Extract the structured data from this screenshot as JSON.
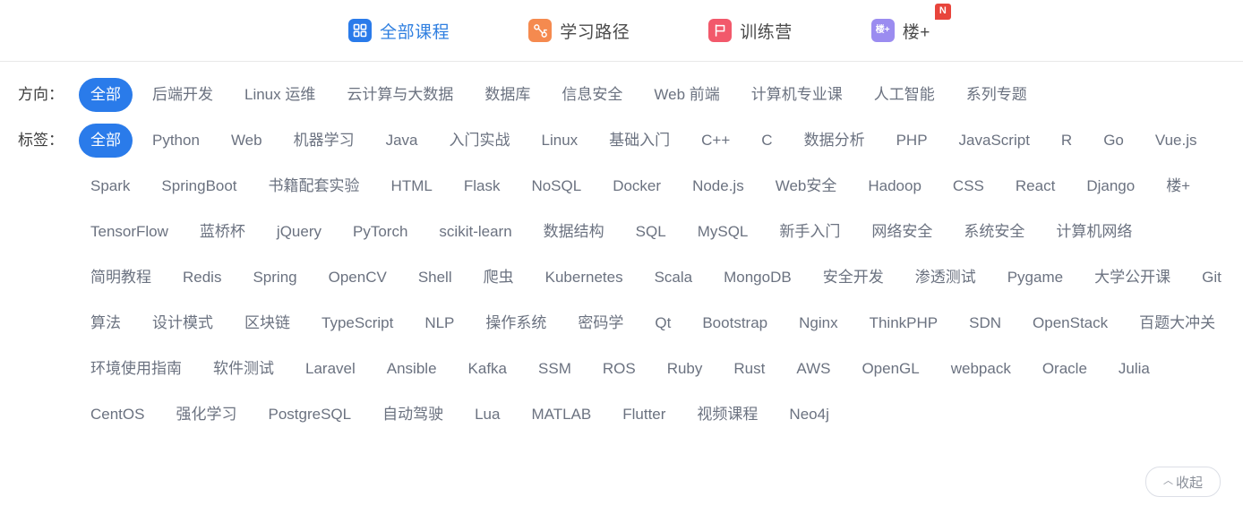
{
  "topnav": {
    "items": [
      {
        "label": "全部课程",
        "icon": "grid-icon",
        "active": true,
        "badge": ""
      },
      {
        "label": "学习路径",
        "icon": "path-icon",
        "active": false,
        "badge": ""
      },
      {
        "label": "训练营",
        "icon": "flag-icon",
        "active": false,
        "badge": ""
      },
      {
        "label": "楼+",
        "icon": "lou-plus-icon",
        "active": false,
        "badge": "N"
      }
    ]
  },
  "filters": {
    "direction": {
      "label": "方向：",
      "items": [
        "全部",
        "后端开发",
        "Linux 运维",
        "云计算与大数据",
        "数据库",
        "信息安全",
        "Web 前端",
        "计算机专业课",
        "人工智能",
        "系列专题"
      ],
      "active_index": 0
    },
    "tags": {
      "label": "标签：",
      "items": [
        "全部",
        "Python",
        "Web",
        "机器学习",
        "Java",
        "入门实战",
        "Linux",
        "基础入门",
        "C++",
        "C",
        "数据分析",
        "PHP",
        "JavaScript",
        "R",
        "Go",
        "Vue.js",
        "Spark",
        "SpringBoot",
        "书籍配套实验",
        "HTML",
        "Flask",
        "NoSQL",
        "Docker",
        "Node.js",
        "Web安全",
        "Hadoop",
        "CSS",
        "React",
        "Django",
        "楼+",
        "TensorFlow",
        "蓝桥杯",
        "jQuery",
        "PyTorch",
        "scikit-learn",
        "数据结构",
        "SQL",
        "MySQL",
        "新手入门",
        "网络安全",
        "系统安全",
        "计算机网络",
        "简明教程",
        "Redis",
        "Spring",
        "OpenCV",
        "Shell",
        "爬虫",
        "Kubernetes",
        "Scala",
        "MongoDB",
        "安全开发",
        "渗透测试",
        "Pygame",
        "大学公开课",
        "Git",
        "算法",
        "设计模式",
        "区块链",
        "TypeScript",
        "NLP",
        "操作系统",
        "密码学",
        "Qt",
        "Bootstrap",
        "Nginx",
        "ThinkPHP",
        "SDN",
        "OpenStack",
        "百题大冲关",
        "环境使用指南",
        "软件测试",
        "Laravel",
        "Ansible",
        "Kafka",
        "SSM",
        "ROS",
        "Ruby",
        "Rust",
        "AWS",
        "OpenGL",
        "webpack",
        "Oracle",
        "Julia",
        "CentOS",
        "强化学习",
        "PostgreSQL",
        "自动驾驶",
        "Lua",
        "MATLAB",
        "Flutter",
        "视频课程",
        "Neo4j"
      ],
      "active_index": 0
    }
  },
  "collapse_button": {
    "label": "收起",
    "caret": "︿"
  },
  "colors": {
    "accent": "#2a7bea",
    "grid_icon_bg": "#2a7bea",
    "path_icon_bg": "#f58a4f",
    "flag_icon_bg": "#f2596b",
    "lou_icon_bg": "#9b8cf0",
    "badge_bg": "#e8453c",
    "chip_text": "#6b7280"
  }
}
